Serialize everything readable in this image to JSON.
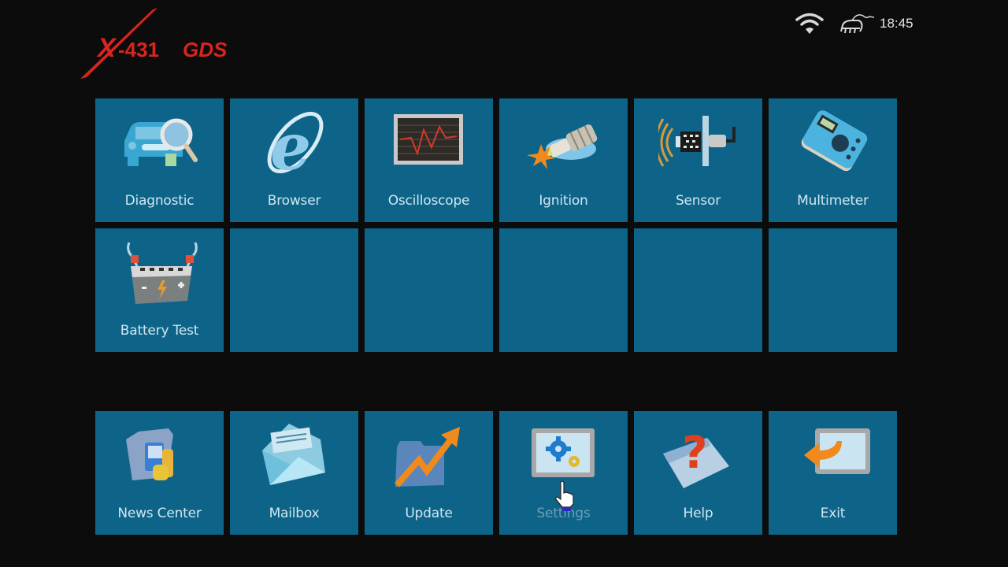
{
  "app": {
    "logo_text": "X-431 GDS",
    "brand_color": "#e02a22"
  },
  "status_bar": {
    "wifi_icon": "wifi-icon",
    "connector_icon": "vci-connector-icon",
    "time": "18:45"
  },
  "function_grid": [
    {
      "label": "Diagnostic",
      "icon": "car-magnifier-icon"
    },
    {
      "label": "Browser",
      "icon": "browser-e-icon"
    },
    {
      "label": "Oscilloscope",
      "icon": "oscilloscope-icon"
    },
    {
      "label": "Ignition",
      "icon": "spark-plug-icon"
    },
    {
      "label": "Sensor",
      "icon": "sensor-icon"
    },
    {
      "label": "Multimeter",
      "icon": "multimeter-icon"
    },
    {
      "label": "Battery Test",
      "icon": "battery-icon"
    },
    {
      "label": "",
      "icon": ""
    },
    {
      "label": "",
      "icon": ""
    },
    {
      "label": "",
      "icon": ""
    },
    {
      "label": "",
      "icon": ""
    },
    {
      "label": "",
      "icon": ""
    }
  ],
  "bottom_bar": [
    {
      "label": "News Center",
      "icon": "news-folder-icon"
    },
    {
      "label": "Mailbox",
      "icon": "mail-envelope-icon"
    },
    {
      "label": "Update",
      "icon": "update-arrow-folder-icon"
    },
    {
      "label": "Settings",
      "icon": "settings-gears-icon"
    },
    {
      "label": "Help",
      "icon": "help-question-icon"
    },
    {
      "label": "Exit",
      "icon": "exit-arrow-icon"
    }
  ],
  "colors": {
    "background": "#0c0c0c",
    "tile": "#0e6488",
    "tile_text": "#cfe6f0"
  }
}
